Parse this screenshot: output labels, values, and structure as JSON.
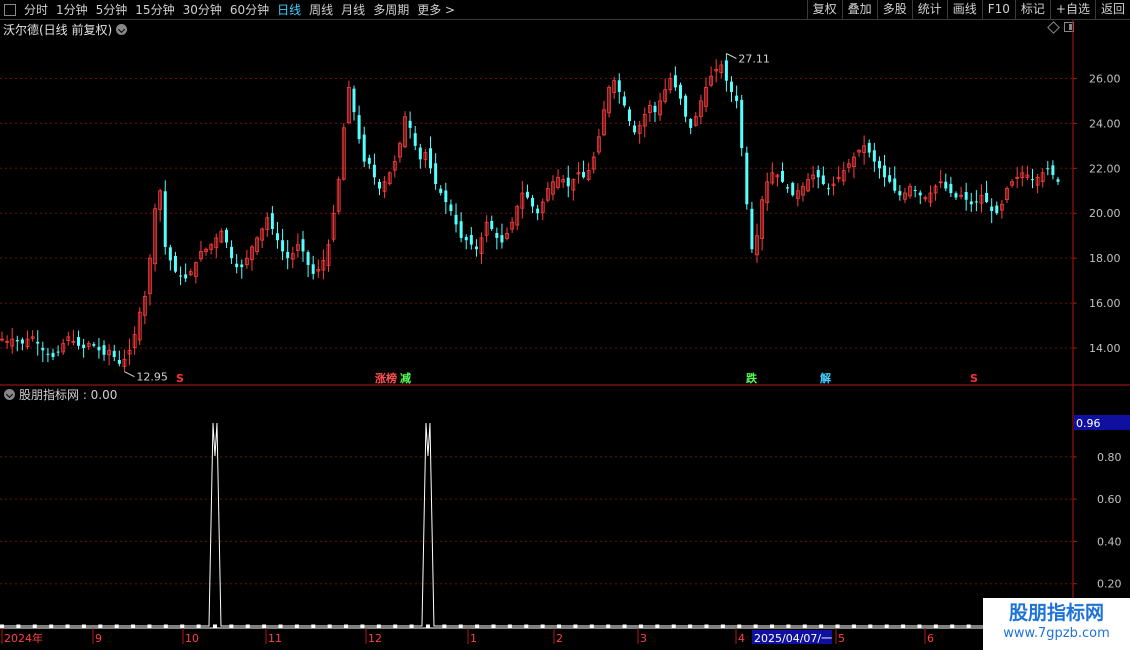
{
  "toolbar": {
    "periods": [
      {
        "label": "分时",
        "active": false
      },
      {
        "label": "1分钟",
        "active": false
      },
      {
        "label": "5分钟",
        "active": false
      },
      {
        "label": "15分钟",
        "active": false
      },
      {
        "label": "30分钟",
        "active": false
      },
      {
        "label": "60分钟",
        "active": false
      },
      {
        "label": "日线",
        "active": true
      },
      {
        "label": "周线",
        "active": false
      },
      {
        "label": "月线",
        "active": false
      },
      {
        "label": "多周期",
        "active": false
      },
      {
        "label": "更多 >",
        "active": false
      }
    ],
    "right_tools": [
      "复权",
      "叠加",
      "多股",
      "统计",
      "画线",
      "F10",
      "标记",
      "+自选",
      "返回"
    ]
  },
  "main_chart": {
    "title": "沃尔德(日线 前复权)",
    "y_ticks": [
      "26.00",
      "24.00",
      "22.00",
      "20.00",
      "18.00",
      "16.00",
      "14.00"
    ],
    "high_label": "27.11",
    "low_label": "12.95",
    "markers": [
      {
        "text": "S",
        "color": "#ff3030"
      },
      {
        "text": "涨榜",
        "color": "#ff5050"
      },
      {
        "text": "减",
        "color": "#50ff50"
      },
      {
        "text": "跌",
        "color": "#50ff50"
      },
      {
        "text": "解",
        "color": "#40d0ff"
      },
      {
        "text": "S",
        "color": "#ff3030"
      }
    ]
  },
  "indicator": {
    "title": "股朋指标网 : 0.00",
    "current_value": "0.96",
    "y_ticks": [
      "0.80",
      "0.60",
      "0.40",
      "0.20"
    ]
  },
  "time_axis": {
    "labels": [
      "2024年",
      "9",
      "10",
      "11",
      "12",
      "1",
      "2",
      "3",
      "4",
      "5",
      "6"
    ],
    "cursor_label": "2025/04/07/一"
  },
  "watermark": {
    "line1": "股朋指标网",
    "line2": "www.7gpzb.com"
  },
  "colors": {
    "up": "#ff3d3d",
    "down": "#54ffff",
    "grid": "#6a1010",
    "axis": "#b01818",
    "indicator_line": "#ffffff"
  },
  "chart_data": {
    "type": "candlestick",
    "title": "沃尔德(日线 前复权)",
    "xlabel": "",
    "ylabel": "",
    "ylim": [
      12.4,
      27.8
    ],
    "grid": true,
    "time_ticks": [
      "2024年",
      "9",
      "10",
      "11",
      "12",
      "1",
      "2",
      "3",
      "4",
      "5",
      "6"
    ],
    "closes": [
      14.4,
      14.3,
      14.4,
      14.3,
      14.2,
      14.4,
      14.5,
      14.2,
      13.9,
      13.7,
      13.6,
      13.8,
      14.2,
      14.5,
      14.3,
      14.1,
      14.0,
      14.2,
      14.1,
      13.9,
      13.7,
      13.9,
      13.6,
      13.3,
      13.5,
      13.9,
      14.6,
      15.6,
      16.3,
      18.0,
      20.2,
      21.0,
      18.5,
      17.9,
      17.4,
      17.2,
      17.1,
      17.4,
      17.8,
      18.3,
      18.4,
      18.6,
      18.9,
      19.2,
      18.7,
      18.0,
      17.6,
      17.6,
      18.0,
      18.5,
      18.9,
      19.3,
      19.8,
      19.3,
      18.8,
      18.3,
      18.0,
      18.2,
      18.6,
      18.3,
      17.7,
      17.3,
      17.5,
      17.9,
      18.6,
      20.0,
      21.5,
      23.8,
      25.6,
      24.5,
      23.3,
      22.3,
      22.2,
      21.6,
      21.1,
      21.4,
      21.8,
      22.3,
      23.1,
      24.3,
      23.8,
      23.0,
      22.4,
      22.7,
      22.0,
      21.3,
      20.9,
      20.5,
      20.1,
      19.5,
      18.9,
      18.8,
      18.6,
      18.4,
      18.9,
      19.6,
      19.3,
      18.9,
      18.7,
      19.1,
      19.6,
      20.3,
      20.9,
      20.7,
      20.3,
      20.0,
      20.5,
      21.1,
      21.4,
      21.6,
      21.5,
      21.2,
      21.5,
      21.8,
      21.6,
      21.9,
      22.5,
      23.4,
      24.6,
      25.6,
      25.9,
      25.4,
      24.8,
      24.1,
      23.6,
      23.9,
      24.4,
      24.8,
      24.5,
      25.0,
      25.5,
      26.0,
      25.6,
      25.1,
      24.3,
      23.8,
      24.3,
      25.0,
      25.6,
      26.1,
      26.4,
      26.6,
      25.9,
      25.4,
      25.0,
      22.9,
      20.4,
      18.4,
      19.0,
      20.6,
      21.4,
      21.8,
      21.7,
      21.4,
      21.1,
      20.8,
      21.0,
      21.2,
      21.5,
      21.7,
      21.6,
      21.3,
      21.1,
      21.3,
      21.6,
      21.9,
      22.2,
      22.5,
      22.8,
      23.0,
      22.7,
      22.3,
      22.0,
      21.6,
      21.4,
      21.0,
      20.8,
      20.9,
      21.2,
      21.0,
      20.8,
      20.7,
      20.9,
      21.2,
      21.4,
      21.1,
      20.9,
      20.7,
      20.8,
      20.6,
      20.4,
      20.5,
      20.8,
      20.5,
      20.1,
      20.0,
      20.4,
      21.1,
      21.4,
      21.6,
      21.8,
      21.7,
      21.5,
      21.6,
      21.8,
      22.0,
      21.7,
      21.4
    ],
    "indicator_series": {
      "name": "股朋指标网",
      "ylim": [
        0,
        1.05
      ],
      "spikes": [
        {
          "index": 13,
          "value": 0.96
        },
        {
          "index": 26,
          "value": 0.96
        }
      ]
    }
  }
}
